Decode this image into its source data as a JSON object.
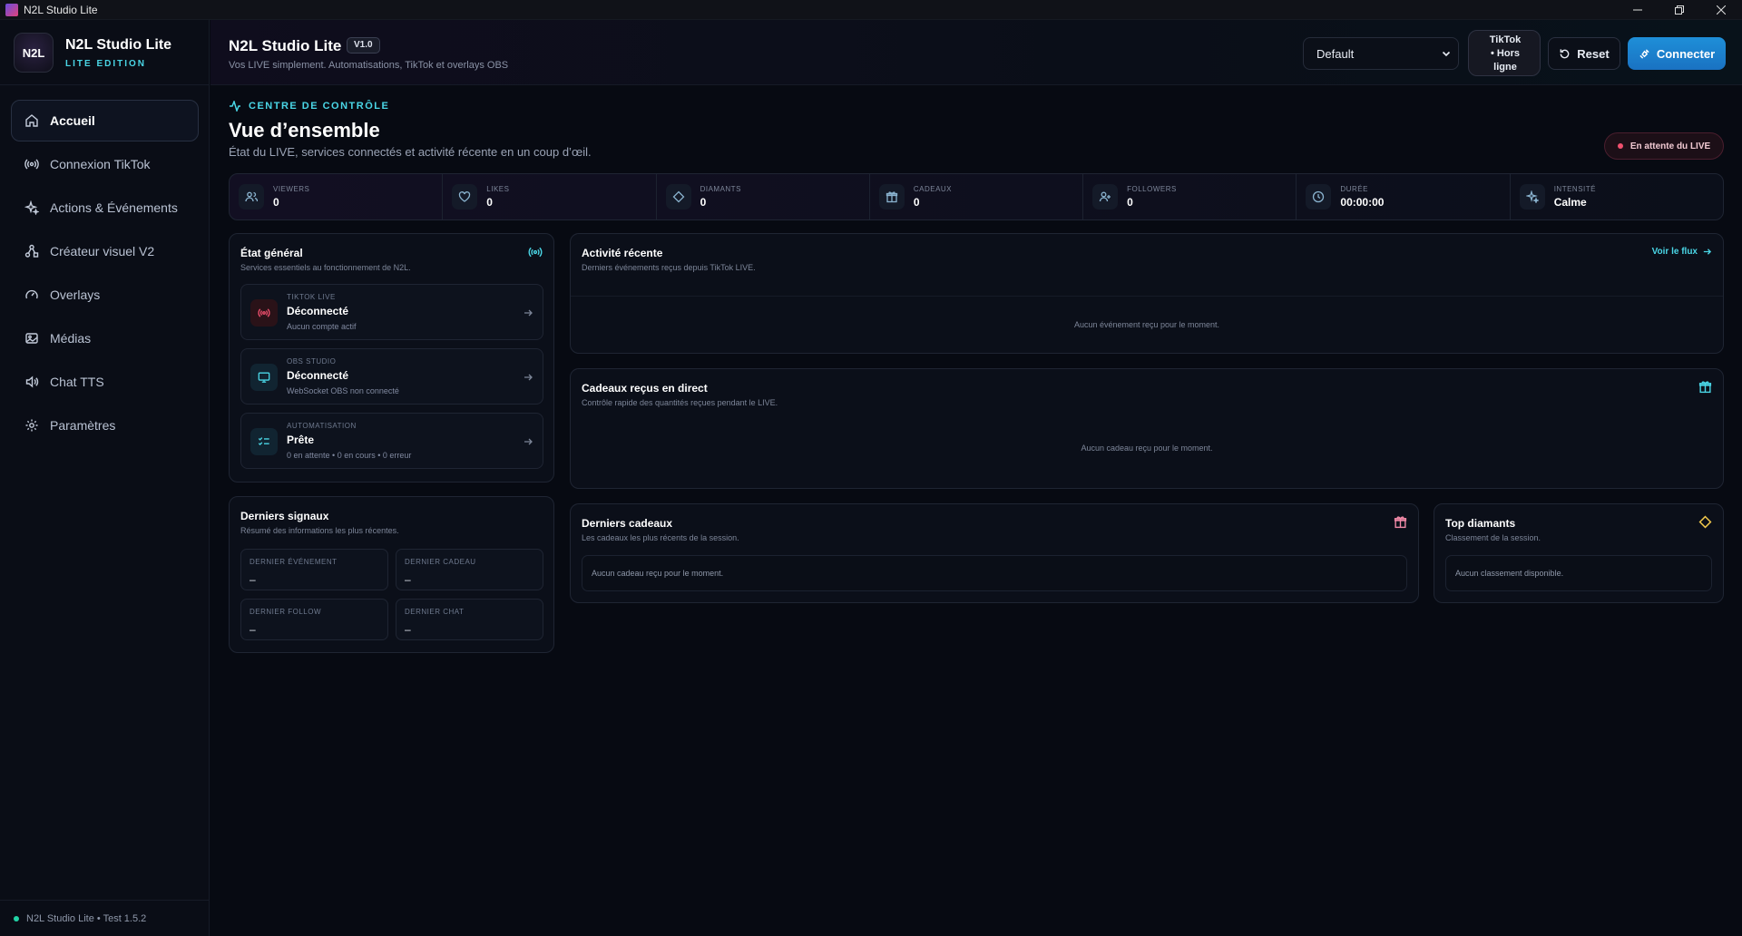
{
  "window": {
    "title": "N2L Studio Lite"
  },
  "sidebar": {
    "brand_title": "N2L Studio Lite",
    "brand_sub": "LITE EDITION",
    "logo_text": "N2L",
    "items": [
      {
        "label": "Accueil",
        "icon": "home-icon"
      },
      {
        "label": "Connexion TikTok",
        "icon": "broadcast-icon"
      },
      {
        "label": "Actions & Événements",
        "icon": "sparkle-icon"
      },
      {
        "label": "Créateur visuel V2",
        "icon": "workflow-icon"
      },
      {
        "label": "Overlays",
        "icon": "gauge-icon"
      },
      {
        "label": "Médias",
        "icon": "image-icon"
      },
      {
        "label": "Chat TTS",
        "icon": "speaker-icon"
      },
      {
        "label": "Paramètres",
        "icon": "gear-icon"
      }
    ],
    "footer": "N2L Studio Lite • Test 1.5.2"
  },
  "header": {
    "title": "N2L Studio Lite",
    "version": "V1.0",
    "subtitle": "Vos LIVE simplement. Automatisations, TikTok et overlays OBS",
    "profile": "Default",
    "tiktok_status_1": "TikTok",
    "tiktok_status_2": "• Hors",
    "tiktok_status_3": "ligne",
    "reset_label": "Reset",
    "connect_label": "Connecter"
  },
  "page": {
    "kicker": "CENTRE DE CONTRÔLE",
    "title": "Vue d’ensemble",
    "subtitle": "État du LIVE, services connectés et activité récente en un coup d’œil.",
    "live_badge": "En attente du LIVE"
  },
  "stats": [
    {
      "label": "VIEWERS",
      "value": "0",
      "icon": "users-icon"
    },
    {
      "label": "LIKES",
      "value": "0",
      "icon": "heart-icon"
    },
    {
      "label": "DIAMANTS",
      "value": "0",
      "icon": "diamond-icon"
    },
    {
      "label": "CADEAUX",
      "value": "0",
      "icon": "gift-icon"
    },
    {
      "label": "FOLLOWERS",
      "value": "0",
      "icon": "user-plus-icon"
    },
    {
      "label": "DURÉE",
      "value": "00:00:00",
      "icon": "clock-icon"
    },
    {
      "label": "INTENSITÉ",
      "value": "Calme",
      "icon": "sparkle-icon"
    }
  ],
  "etat": {
    "title": "État général",
    "subtitle": "Services essentiels au fonctionnement de N2L.",
    "services": [
      {
        "label": "TIKTOK LIVE",
        "status": "Déconnecté",
        "detail": "Aucun compte actif"
      },
      {
        "label": "OBS STUDIO",
        "status": "Déconnecté",
        "detail": "WebSocket OBS non connecté"
      },
      {
        "label": "AUTOMATISATION",
        "status": "Prête",
        "detail": "0 en attente • 0 en cours • 0 erreur"
      }
    ]
  },
  "signaux": {
    "title": "Derniers signaux",
    "subtitle": "Résumé des informations les plus récentes.",
    "items": [
      {
        "label": "DERNIER ÉVÉNEMENT",
        "value": "–"
      },
      {
        "label": "DERNIER CADEAU",
        "value": "–"
      },
      {
        "label": "DERNIER FOLLOW",
        "value": "–"
      },
      {
        "label": "DERNIER CHAT",
        "value": "–"
      }
    ]
  },
  "activite": {
    "title": "Activité récente",
    "subtitle": "Derniers événements reçus depuis TikTok LIVE.",
    "link": "Voir le flux",
    "empty": "Aucun événement reçu pour le moment."
  },
  "cadeaux_direct": {
    "title": "Cadeaux reçus en direct",
    "subtitle": "Contrôle rapide des quantités reçues pendant le LIVE.",
    "empty": "Aucun cadeau reçu pour le moment."
  },
  "derniers_cadeaux": {
    "title": "Derniers cadeaux",
    "subtitle": "Les cadeaux les plus récents de la session.",
    "empty": "Aucun cadeau reçu pour le moment."
  },
  "top_diamants": {
    "title": "Top diamants",
    "subtitle": "Classement de la session.",
    "empty": "Aucun classement disponible."
  },
  "colors": {
    "accent": "#4ad6e6",
    "primary": "#1a80cc",
    "danger": "#f0506e"
  }
}
